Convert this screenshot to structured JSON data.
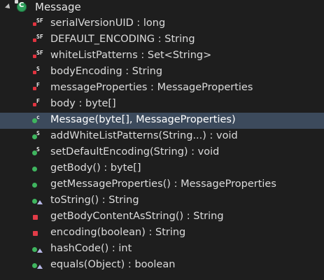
{
  "tree": {
    "class_name": "Message",
    "members": [
      {
        "name": "serialVersionUID",
        "sep": " : ",
        "type": "long",
        "icon": "private-static-final-field-icon"
      },
      {
        "name": "DEFAULT_ENCODING",
        "sep": " : ",
        "type": "String",
        "icon": "private-static-final-field-icon"
      },
      {
        "name": "whiteListPatterns",
        "sep": " : ",
        "type": "Set<String>",
        "icon": "private-static-final-field-icon"
      },
      {
        "name": "bodyEncoding",
        "sep": " : ",
        "type": "String",
        "icon": "private-static-field-icon"
      },
      {
        "name": "messageProperties",
        "sep": " : ",
        "type": "MessageProperties",
        "icon": "private-final-field-icon"
      },
      {
        "name": "body",
        "sep": " : ",
        "type": "byte[]",
        "icon": "private-final-field-icon"
      },
      {
        "name": "Message(byte[], MessageProperties)",
        "sep": "",
        "type": "",
        "icon": "public-constructor-icon"
      },
      {
        "name": "addWhiteListPatterns(String...)",
        "sep": " : ",
        "type": "void",
        "icon": "public-static-method-icon"
      },
      {
        "name": "setDefaultEncoding(String)",
        "sep": " : ",
        "type": "void",
        "icon": "public-static-method-icon"
      },
      {
        "name": "getBody()",
        "sep": " : ",
        "type": "byte[]",
        "icon": "public-method-icon"
      },
      {
        "name": "getMessageProperties()",
        "sep": " : ",
        "type": "MessageProperties",
        "icon": "public-method-icon"
      },
      {
        "name": "toString()",
        "sep": " : ",
        "type": "String",
        "icon": "public-override-method-icon"
      },
      {
        "name": "getBodyContentAsString()",
        "sep": " : ",
        "type": "String",
        "icon": "private-method-icon"
      },
      {
        "name": "encoding(boolean)",
        "sep": " : ",
        "type": "String",
        "icon": "private-method-icon"
      },
      {
        "name": "hashCode()",
        "sep": " : ",
        "type": "int",
        "icon": "public-override-method-icon"
      },
      {
        "name": "equals(Object)",
        "sep": " : ",
        "type": "boolean",
        "icon": "public-override-method-icon"
      }
    ],
    "selected_index": 6
  },
  "colors": {
    "background": "#1e1e1e",
    "selection": "#3c4a5c",
    "text": "#dcdcdc",
    "private": "#e23c48",
    "public": "#3fb55f"
  }
}
